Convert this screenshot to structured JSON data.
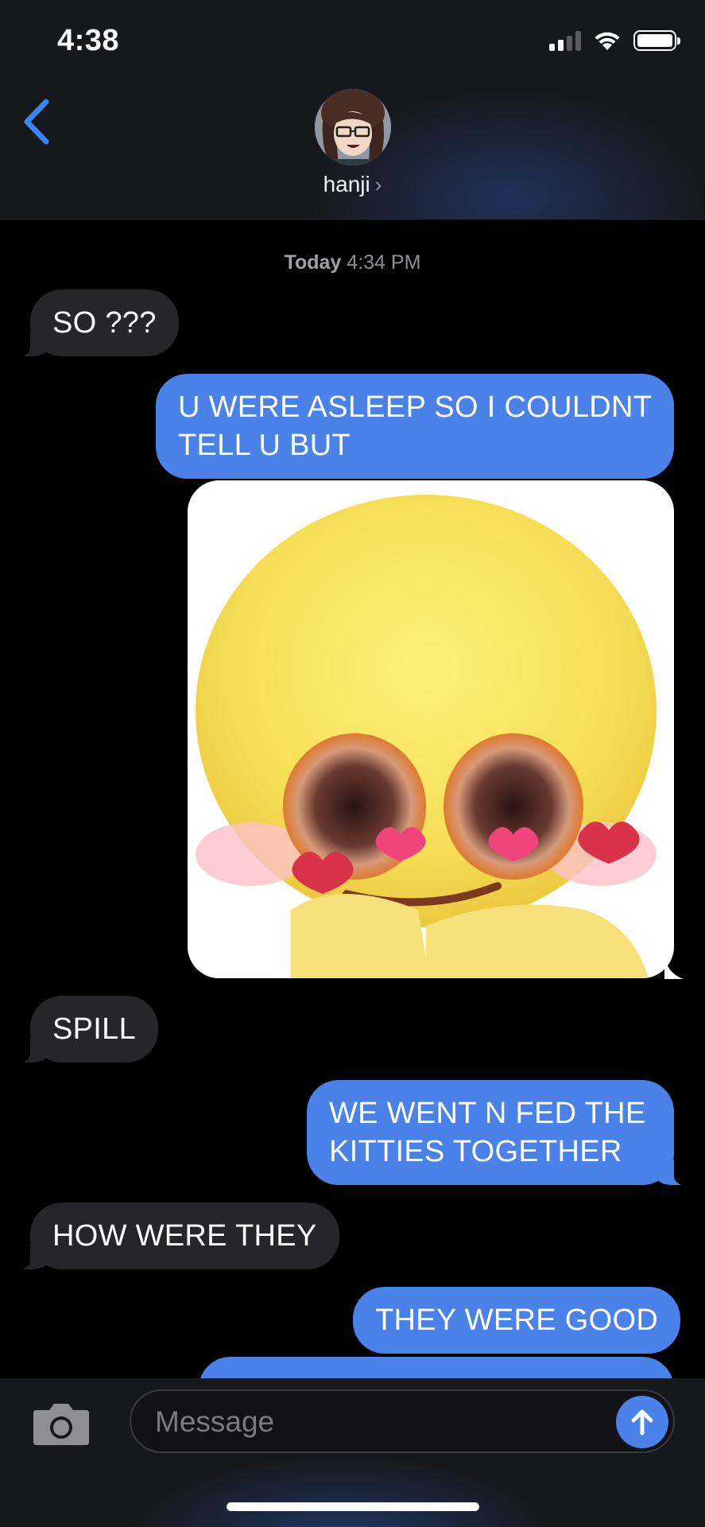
{
  "status_bar": {
    "time": "4:38"
  },
  "header": {
    "contact_name": "hanji",
    "contact_chevron": "›"
  },
  "thread": {
    "timestamp_day": "Today",
    "timestamp_time": "4:34 PM",
    "messages": [
      {
        "from": "them",
        "text": "SO ???"
      },
      {
        "from": "me",
        "line1": "U WERE ASLEEP SO I COULDNT",
        "line2": "TELL U BUT"
      },
      {
        "from": "me",
        "type": "image",
        "description_icon": "heart-eyes-emoji-image"
      },
      {
        "from": "them",
        "text": "SPILL"
      },
      {
        "from": "me",
        "line1": "WE WENT N FED THE",
        "line2": "KITTIES TOGETHER"
      },
      {
        "from": "them",
        "text": "HOW WERE THEY"
      },
      {
        "from": "me",
        "text": "THEY WERE GOOD"
      }
    ]
  },
  "composer": {
    "placeholder": "Message"
  },
  "colors": {
    "outgoing": "#4a82e9",
    "incoming": "#26262a",
    "accent": "#3a86f0"
  },
  "icons": [
    "back-chevron-icon",
    "camera-icon",
    "send-arrow-icon",
    "signal-icon",
    "wifi-icon",
    "battery-icon"
  ]
}
